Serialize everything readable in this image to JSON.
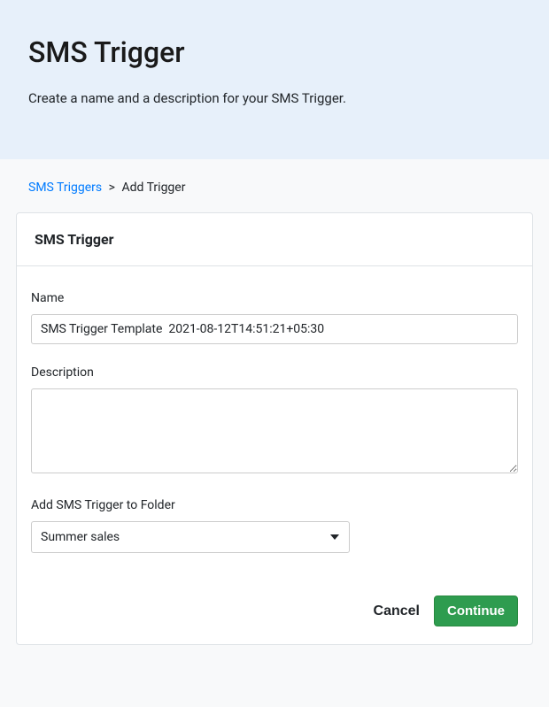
{
  "header": {
    "title": "SMS Trigger",
    "subtitle": "Create a name and a description for your SMS Trigger."
  },
  "breadcrumb": {
    "link_label": "SMS Triggers",
    "separator": ">",
    "current": "Add Trigger"
  },
  "card": {
    "title": "SMS Trigger"
  },
  "form": {
    "name_label": "Name",
    "name_value": "SMS Trigger Template  2021-08-12T14:51:21+05:30",
    "description_label": "Description",
    "description_value": "",
    "folder_label": "Add SMS Trigger to Folder",
    "folder_selected": "Summer sales"
  },
  "actions": {
    "cancel": "Cancel",
    "continue": "Continue"
  }
}
